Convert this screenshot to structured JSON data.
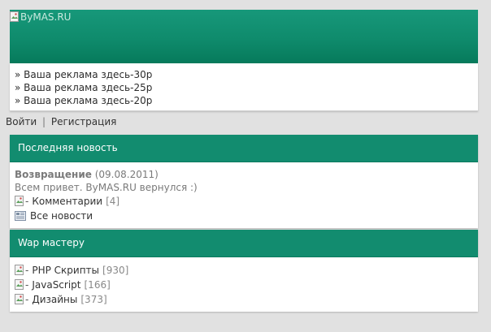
{
  "header": {
    "logo_alt": "ByMAS.RU"
  },
  "ads": [
    "» Ваша реклама здесь-30р",
    "» Ваша реклама здесь-25р",
    "» Ваша реклама здесь-20р"
  ],
  "auth": {
    "login": "Войти",
    "separator": "|",
    "register": "Регистрация"
  },
  "latest_news": {
    "title": "Последняя новость",
    "headline": "Возвращение",
    "date": "(09.08.2011)",
    "text": "Всем привет. ByMAS.RU вернулся :)",
    "comments_label": "Комментарии",
    "comments_count": "[4]",
    "all_news_label": "Все новости"
  },
  "wap": {
    "title": "Wap мастеру",
    "items": [
      {
        "label": "PHP Скрипты",
        "count": "[930]"
      },
      {
        "label": "JavaScript",
        "count": "[166]"
      },
      {
        "label": "Дизайны",
        "count": "[373]"
      }
    ]
  }
}
